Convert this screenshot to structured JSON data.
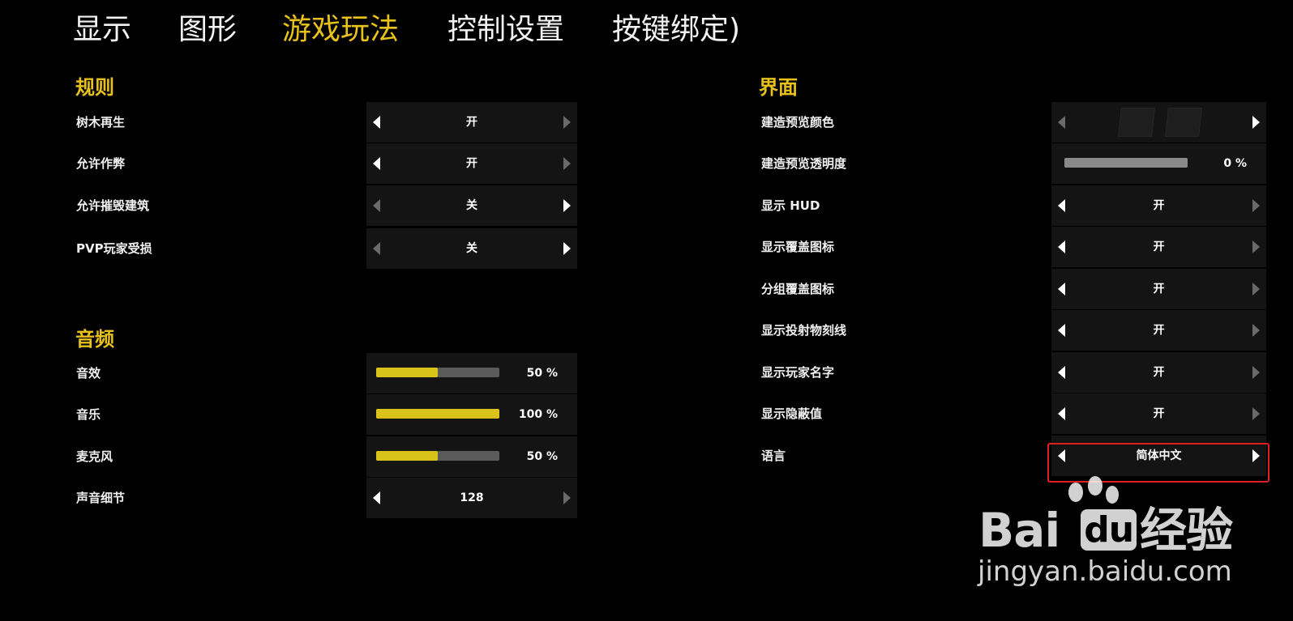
{
  "tabs": [
    {
      "label": "显示",
      "active": false
    },
    {
      "label": "图形",
      "active": false
    },
    {
      "label": "游戏玩法",
      "active": true
    },
    {
      "label": "控制设置",
      "active": false
    },
    {
      "label": "按键绑定)",
      "active": false
    }
  ],
  "rules": {
    "title": "规则",
    "items": [
      {
        "label": "树木再生",
        "value": "开"
      },
      {
        "label": "允许作弊",
        "value": "开"
      },
      {
        "label": "允许摧毁建筑",
        "value": "关"
      },
      {
        "label": "PVP玩家受损",
        "value": "关"
      }
    ]
  },
  "audio": {
    "title": "音频",
    "sliders": [
      {
        "label": "音效",
        "value": "50 %",
        "level": 0.5
      },
      {
        "label": "音乐",
        "value": "100 %",
        "level": 1.0
      },
      {
        "label": "麦克风",
        "value": "50 %",
        "level": 0.5
      }
    ],
    "detail": {
      "label": "声音细节",
      "value": "128"
    }
  },
  "interface": {
    "title": "界面",
    "preview_color": {
      "label": "建造预览颜色"
    },
    "preview_opacity": {
      "label": "建造预览透明度",
      "value": "0 %",
      "level": 0.0
    },
    "items": [
      {
        "label": "显示 HUD",
        "value": "开"
      },
      {
        "label": "显示覆盖图标",
        "value": "开"
      },
      {
        "label": "分组覆盖图标",
        "value": "开"
      },
      {
        "label": "显示投射物刻线",
        "value": "开"
      },
      {
        "label": "显示玩家名字",
        "value": "开"
      },
      {
        "label": "显示隐蔽值",
        "value": "开"
      }
    ],
    "language": {
      "label": "语言",
      "value": "简体中文"
    }
  },
  "watermark": {
    "logo": "Bai du 经验",
    "logo_a": "Bai",
    "logo_b": "经验",
    "url": "jingyan.baidu.com"
  },
  "colors": {
    "accent": "#e8c21a",
    "highlight": "#e02020",
    "panel": "#141414"
  }
}
